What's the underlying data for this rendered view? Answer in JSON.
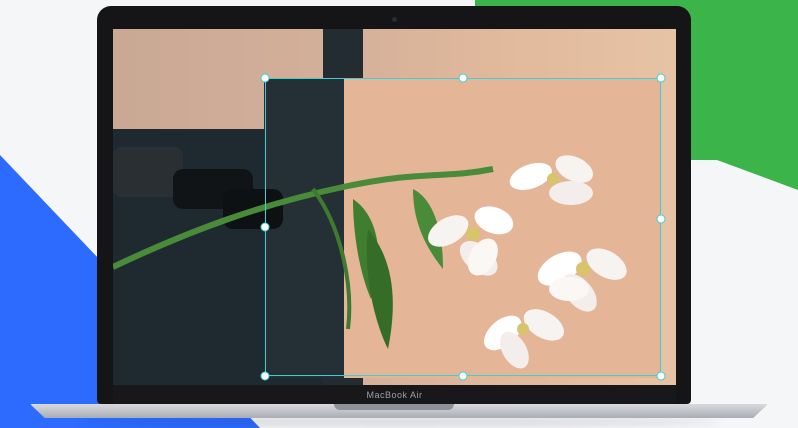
{
  "device": {
    "model_label": "MacBook Air"
  },
  "colors": {
    "background": "#f5f6f8",
    "accent_green": "#3bb54a",
    "accent_blue": "#2d6bff",
    "selection": "#3fd0d6"
  },
  "canvas": {
    "image_subject": "flower-photo",
    "selection": {
      "handles": [
        "top-left",
        "top-center",
        "top-right",
        "middle-left",
        "middle-right",
        "bottom-left",
        "bottom-center",
        "bottom-right"
      ]
    }
  }
}
